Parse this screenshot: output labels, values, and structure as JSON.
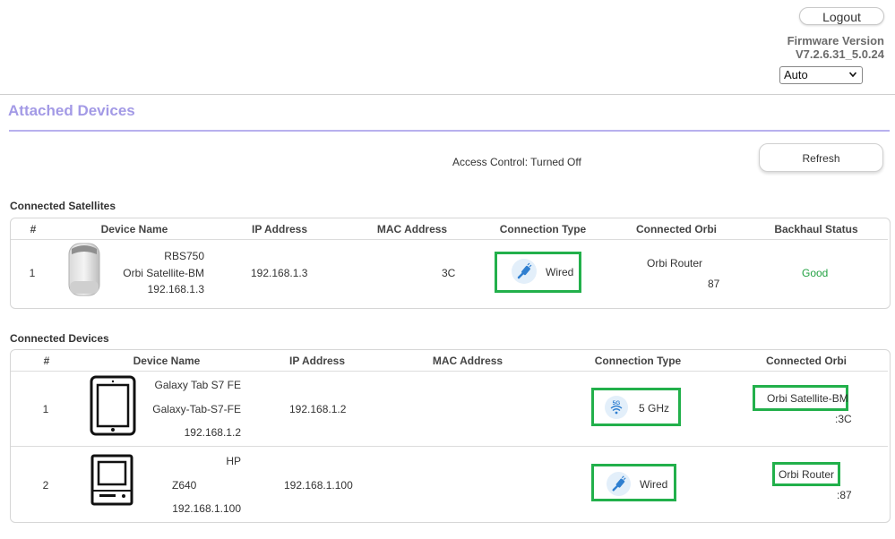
{
  "header": {
    "logout_label": "Logout",
    "firmware_label": "Firmware Version",
    "firmware_version": "V7.2.6.31_5.0.24",
    "language_selected": "Auto"
  },
  "page": {
    "title": "Attached Devices",
    "access_control": "Access Control: Turned Off",
    "refresh_label": "Refresh"
  },
  "satellites": {
    "title": "Connected Satellites",
    "columns": [
      "#",
      "Device Name",
      "IP Address",
      "MAC Address",
      "Connection Type",
      "Connected Orbi",
      "Backhaul Status"
    ],
    "rows": [
      {
        "index": "1",
        "model": "RBS750",
        "name": "Orbi Satellite-BM",
        "name_ip": "192.168.1.3",
        "ip": "192.168.1.3",
        "mac": "3C",
        "connection": "Wired",
        "orbi": "Orbi Router",
        "orbi_mac": "87",
        "backhaul": "Good",
        "icon": "orbi-satellite-device-icon"
      }
    ]
  },
  "devices": {
    "title": "Connected Devices",
    "columns": [
      "#",
      "Device Name",
      "IP Address",
      "MAC Address",
      "Connection Type",
      "Connected Orbi"
    ],
    "rows": [
      {
        "index": "1",
        "model": "Galaxy Tab S7 FE",
        "name": "Galaxy-Tab-S7-FE",
        "name_ip": "192.168.1.2",
        "ip": "192.168.1.2",
        "connection": "5 GHz",
        "conn_icon": "5g-wifi-icon",
        "orbi": "Orbi Satellite-BM",
        "orbi_mac": ":3C",
        "icon": "tablet-icon"
      },
      {
        "index": "2",
        "model": "HP",
        "name": "Z640",
        "name_ip": "192.168.1.100",
        "ip": "192.168.1.100",
        "connection": "Wired",
        "conn_icon": "ethernet-cable-icon",
        "orbi": "Orbi Router",
        "orbi_mac": ":87",
        "icon": "desktop-computer-icon"
      }
    ]
  },
  "colors": {
    "title": "#a39ae6",
    "highlight": "#22b04b",
    "good": "#23a243",
    "icon_circle": "#e3effa",
    "icon_blue": "#2f7fd0"
  }
}
